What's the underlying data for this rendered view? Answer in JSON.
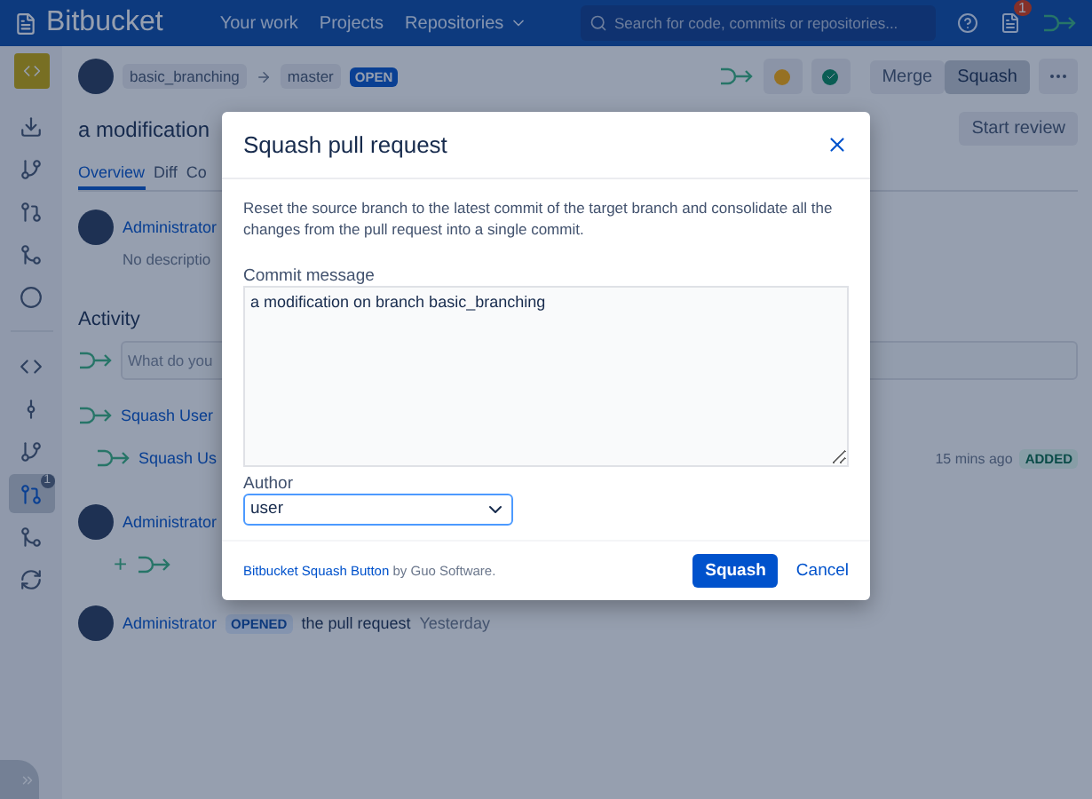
{
  "header": {
    "logo": "Bitbucket",
    "nav": [
      {
        "label": "Your work"
      },
      {
        "label": "Projects"
      },
      {
        "label": "Repositories",
        "dropdown": true
      }
    ],
    "search": {
      "placeholder": "Search for code, commits or repositories..."
    },
    "notifications": "1"
  },
  "sidebar": {
    "groups": [
      {
        "items": [
          {
            "kind": "clone",
            "selected": false
          },
          {
            "kind": "branch",
            "selected": false
          },
          {
            "kind": "pull",
            "selected": false
          },
          {
            "kind": "fork",
            "selected": false
          },
          {
            "kind": "compare",
            "selected": false
          }
        ]
      },
      {
        "items": [
          {
            "kind": "source",
            "selected": false
          },
          {
            "kind": "commit",
            "selected": false
          },
          {
            "kind": "branch",
            "selected": false
          },
          {
            "kind": "pull",
            "selected": true,
            "badge": "1"
          },
          {
            "kind": "fork",
            "selected": false
          },
          {
            "kind": "sync",
            "selected": false
          }
        ]
      }
    ]
  },
  "pull_request": {
    "source": "basic_branching",
    "target": "master",
    "state": "OPEN",
    "title": "a modification",
    "actions": [
      {
        "label": "Merge",
        "selected": false
      },
      {
        "label": "Squash",
        "selected": true
      }
    ],
    "start_review": "Start review"
  },
  "tabs": [
    {
      "label": "Overview",
      "selected": true
    },
    {
      "label": "Diff",
      "selected": false
    },
    {
      "label": "Co",
      "selected": false
    }
  ],
  "description": {
    "author": "Administrator",
    "text": "No descriptio"
  },
  "activity": {
    "title": "Activity",
    "comment_placeholder": "What do you",
    "events": [
      {
        "kind": "user",
        "author": "Squash User",
        "children": [
          {
            "author": "Squash Us",
            "time": "15 mins ago",
            "status": "ADDED"
          }
        ]
      },
      {
        "kind": "admin-added",
        "author": "Administrator",
        "plus": "+"
      },
      {
        "kind": "admin-opened",
        "author": "Administrator",
        "status": "OPENED",
        "text": "the pull request",
        "time": "Yesterday"
      }
    ]
  },
  "modal": {
    "title": "Squash pull request",
    "description": "Reset the source branch to the latest commit of the target branch and consolidate all the changes from the pull request into a single commit.",
    "commit_label": "Commit message",
    "commit_message": "a modification on branch basic_branching",
    "author_label": "Author",
    "author": "user",
    "footer_link": "Bitbucket Squash Button",
    "footer_text": "by Guo Software.",
    "buttons": [
      {
        "label": "Squash",
        "kind": "primary"
      },
      {
        "label": "Cancel",
        "kind": "link"
      }
    ]
  }
}
